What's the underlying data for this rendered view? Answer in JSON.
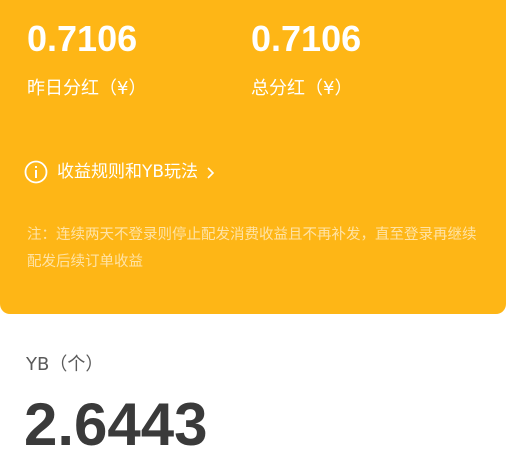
{
  "dividends": {
    "yesterday": {
      "value": "0.7106",
      "label": "昨日分红（¥）"
    },
    "total": {
      "value": "0.7106",
      "label": "总分红（¥）"
    }
  },
  "rules_link": {
    "label": "收益规则和YB玩法",
    "icon": "info-icon",
    "arrow_icon": "chevron-right-icon"
  },
  "notice": "注：连续两天不登录则停止配发消费收益且不再补发，直至登录再继续配发后续订单收益",
  "yb": {
    "label": "YB（个）",
    "value": "2.6443"
  },
  "colors": {
    "card_background": "#FEB616",
    "text_on_card": "#FFFFFF",
    "yb_value": "#3A3A3A"
  }
}
